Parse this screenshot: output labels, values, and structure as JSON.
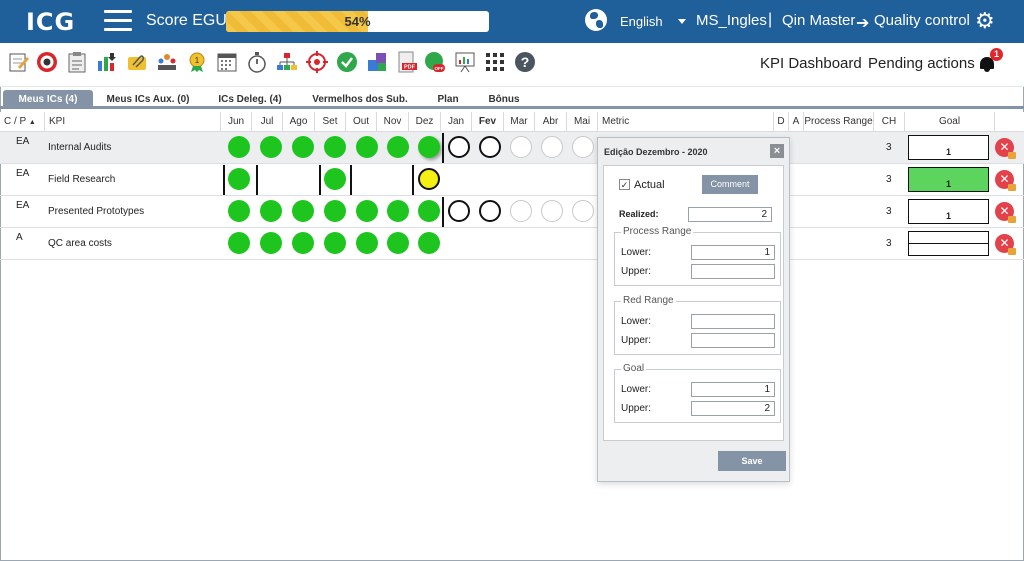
{
  "header": {
    "logo": "ICG",
    "score_label": "Score EGU:",
    "score_text": "54%",
    "score_percent": 54,
    "language": "English",
    "user": "MS_Ingles",
    "separator": "|",
    "breadcrumb_parent": "Qin Master",
    "breadcrumb_current": "Quality control"
  },
  "toolbar": {
    "icons": [
      "edit-icon",
      "target-icon",
      "clipboard-icon",
      "chart-down-icon",
      "attach-icon",
      "team-icon",
      "award-icon",
      "calendar-icon",
      "stopwatch-icon",
      "hierarchy-icon",
      "crosshair-icon",
      "check-circle-icon",
      "puzzle-icon",
      "pdf-icon",
      "toggle-off-icon",
      "presentation-icon",
      "grid-icon",
      "help-icon"
    ],
    "kpi_dashboard": "KPI Dashboard",
    "pending_actions": "Pending actions",
    "notifications_count": "1"
  },
  "tabs": [
    {
      "label": "Meus ICs (4)",
      "active": true
    },
    {
      "label": "Meus ICs Aux. (0)",
      "active": false
    },
    {
      "label": "ICs Deleg. (4)",
      "active": false
    },
    {
      "label": "Vermelhos dos Sub.",
      "active": false
    },
    {
      "label": "Plan",
      "active": false
    },
    {
      "label": "Bônus",
      "active": false
    }
  ],
  "grid": {
    "headers": {
      "cp": "C / P",
      "kpi": "KPI",
      "months": [
        "Jun",
        "Jul",
        "Ago",
        "Set",
        "Out",
        "Nov",
        "Dez",
        "Jan",
        "Fev",
        "Mar",
        "Abr",
        "Mai"
      ],
      "metric": "Metric",
      "d": "D",
      "a": "A",
      "process_range": "Process Range",
      "ch": "CH",
      "goal": "Goal"
    },
    "rows": [
      {
        "cp": "EA",
        "kpi": "Internal Audits",
        "ch": "3",
        "goal": "1"
      },
      {
        "cp": "EA",
        "kpi": "Field Research",
        "ch": "3",
        "goal": "1"
      },
      {
        "cp": "EA",
        "kpi": "Presented Prototypes",
        "ch": "3",
        "goal": "1"
      },
      {
        "cp": "A",
        "kpi": "QC area costs",
        "ch": "3",
        "goal": ""
      }
    ]
  },
  "dialog": {
    "title": "Edição Dezembro - 2020",
    "close": "×",
    "actual_label": "Actual",
    "actual_checked": "✓",
    "comment_button": "Comment",
    "realized_label": "Realized:",
    "realized_value": "2",
    "process_range": {
      "legend": "Process Range",
      "lower_label": "Lower:",
      "lower_value": "1",
      "upper_label": "Upper:",
      "upper_value": ""
    },
    "red_range": {
      "legend": "Red Range",
      "lower_label": "Lower:",
      "lower_value": "",
      "upper_label": "Upper:",
      "upper_value": ""
    },
    "goal": {
      "legend": "Goal",
      "lower_label": "Lower:",
      "lower_value": "1",
      "upper_label": "Upper:",
      "upper_value": "2"
    },
    "save_button": "Save"
  },
  "colors": {
    "header_bg": "#1f5f9a",
    "tab_active": "#8494a6",
    "status_green": "#1ec51e",
    "status_yellow": "#f4f014",
    "delete_red": "#e3424a"
  }
}
